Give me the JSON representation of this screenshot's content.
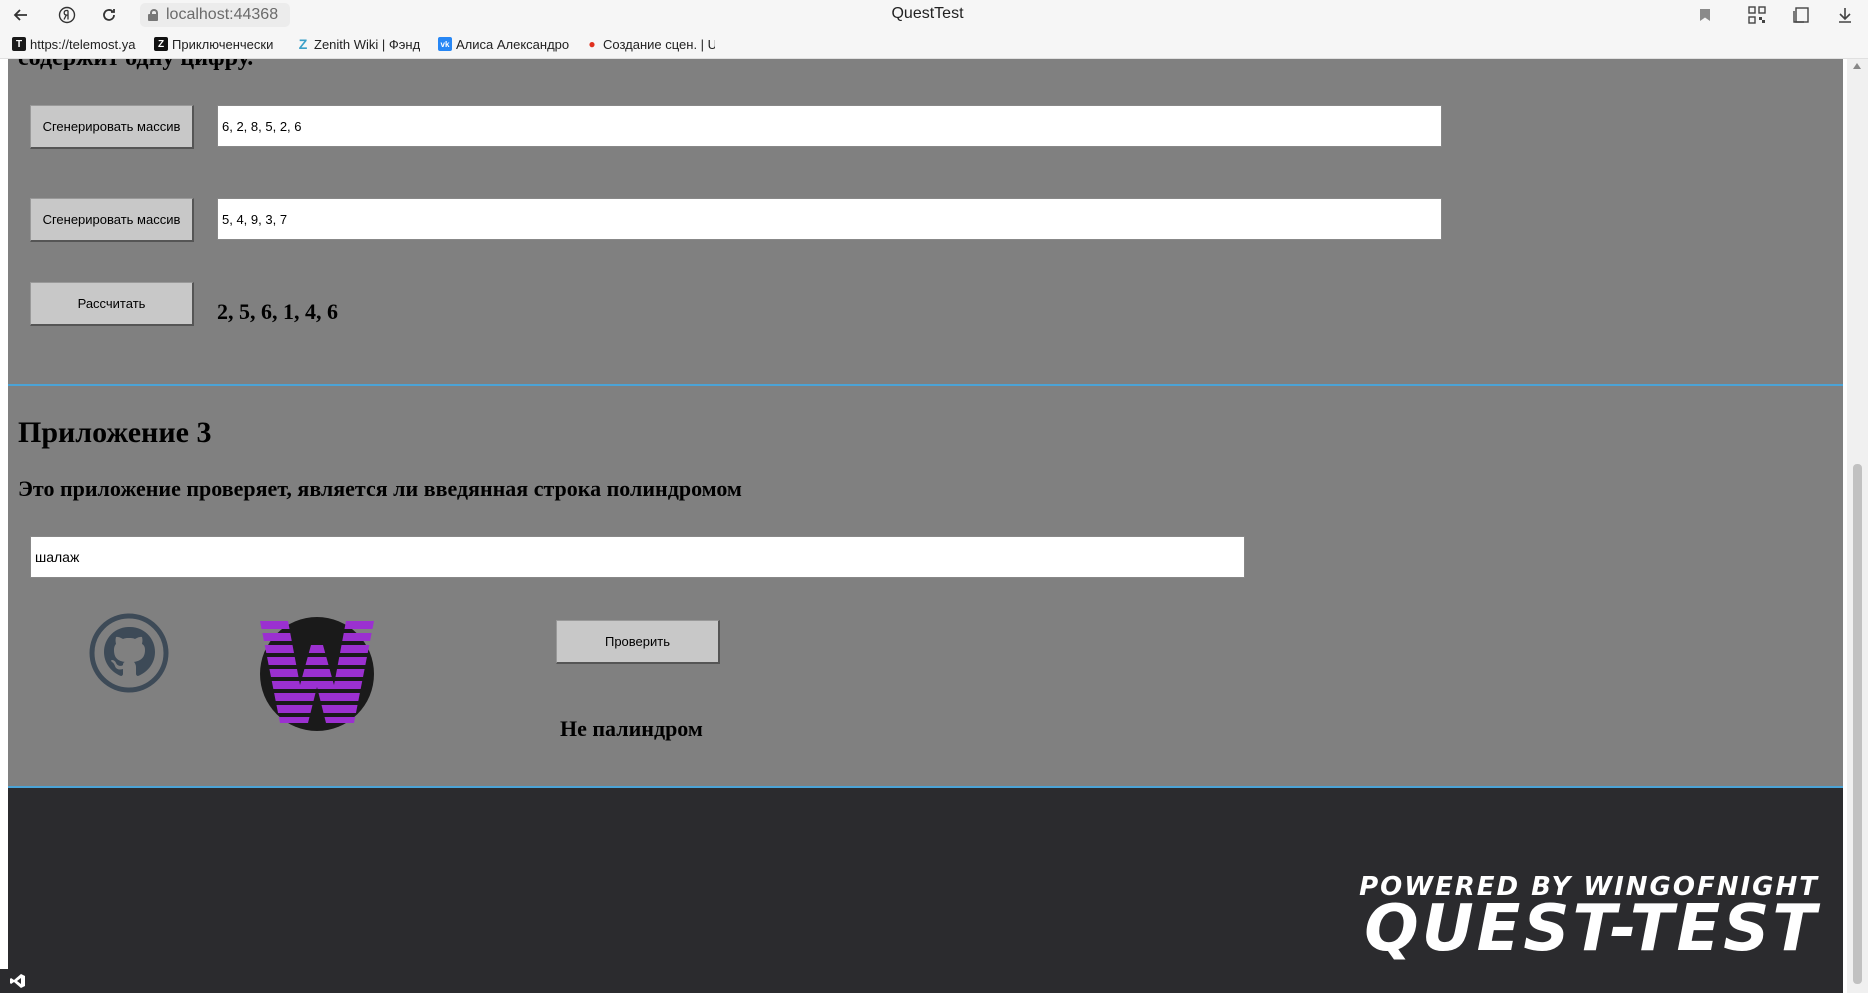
{
  "browser": {
    "address": "localhost:44368",
    "title": "QuestTest",
    "icons": [
      "back-icon",
      "yandex-icon",
      "reload-icon",
      "lock-icon",
      "bookmark-icon",
      "qr-icon",
      "collections-icon",
      "download-icon"
    ]
  },
  "bookmarks": [
    {
      "label": "https://telemost.ya",
      "fav": "T",
      "color": "#1a1a1a"
    },
    {
      "label": "Приключенчески",
      "fav": "Z",
      "color": "#111111"
    },
    {
      "label": "Zenith Wiki | Фэнд",
      "fav": "Z",
      "color": "#3aa0c8"
    },
    {
      "label": "Алиса Александро",
      "fav": "vk",
      "color": "#2787f5"
    },
    {
      "label": "Создание сцен. | U",
      "fav": "●",
      "color": "#e0301e"
    }
  ],
  "app2": {
    "cut_heading": "содержит одну цифру.",
    "gen_button_1": "Сгенерировать массив",
    "array_1": "6, 2, 8, 5, 2, 6",
    "gen_button_2": "Сгенерировать массив",
    "array_2": "5, 4, 9, 3, 7",
    "calc_button": "Рассчитать",
    "result": "2, 5, 6, 1, 4, 6"
  },
  "app3": {
    "title": "Приложение 3",
    "description": "Это приложение проверяет, является ли введянная строка полиндромом",
    "input_value": "шалаж",
    "check_button": "Проверить",
    "result": "Не палиндром",
    "logo_letter": "W"
  },
  "footer": {
    "powered": "POWERED BY WINGOFNIGHT",
    "brand": "QUEST-TEST"
  },
  "colors": {
    "page_bg": "#808080",
    "footer_bg": "#2b2b2e",
    "divider": "#4ba3d6",
    "logo_purple": "#9b30d0"
  }
}
